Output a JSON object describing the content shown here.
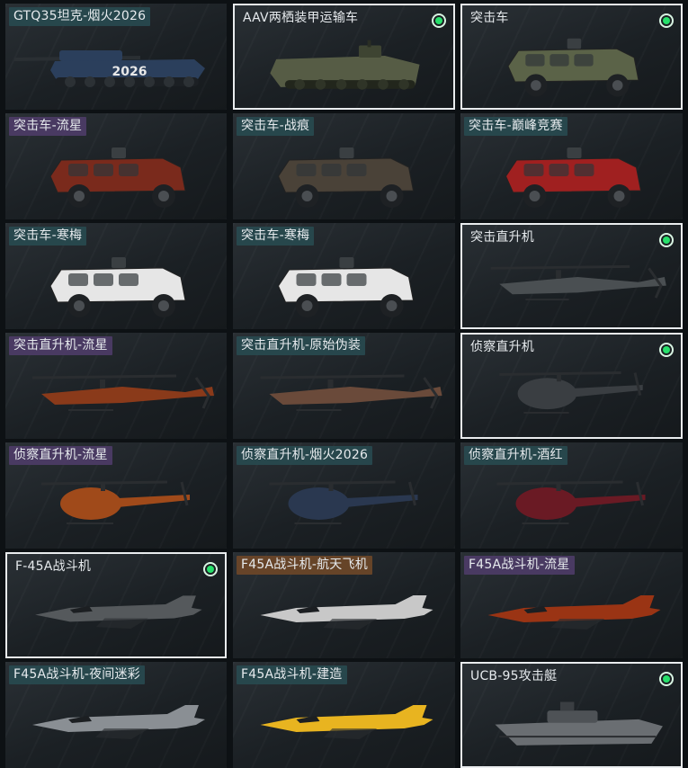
{
  "items": [
    {
      "label": "GTQ35坦克-烟火2026",
      "tag": "teal",
      "selected": false,
      "owned": false,
      "icon": "tank-icon",
      "badge": "2026",
      "color": "#2b3f5c"
    },
    {
      "label": "AAV两栖装甲运输车",
      "tag": "plain",
      "selected": true,
      "owned": true,
      "icon": "amphibious-vehicle-icon",
      "color": "#565c45"
    },
    {
      "label": "突击车",
      "tag": "plain",
      "selected": true,
      "owned": true,
      "icon": "assault-vehicle-icon",
      "color": "#5b6348"
    },
    {
      "label": "突击车-流星",
      "tag": "purple",
      "selected": false,
      "owned": false,
      "icon": "assault-vehicle-icon",
      "color": "#7a2a1c"
    },
    {
      "label": "突击车-战痕",
      "tag": "teal",
      "selected": false,
      "owned": false,
      "icon": "assault-vehicle-icon",
      "color": "#4a4238"
    },
    {
      "label": "突击车-巅峰竞赛",
      "tag": "teal",
      "selected": false,
      "owned": false,
      "icon": "assault-vehicle-icon",
      "color": "#a02020"
    },
    {
      "label": "突击车-寒梅",
      "tag": "teal",
      "selected": false,
      "owned": false,
      "icon": "assault-vehicle-icon",
      "color": "#e6e6e6"
    },
    {
      "label": "突击车-寒梅",
      "tag": "teal",
      "selected": false,
      "owned": false,
      "icon": "assault-vehicle-icon",
      "color": "#e6e6e6"
    },
    {
      "label": "突击直升机",
      "tag": "plain",
      "selected": true,
      "owned": true,
      "icon": "attack-helicopter-icon",
      "color": "#4a4f52"
    },
    {
      "label": "突击直升机-流星",
      "tag": "purple",
      "selected": false,
      "owned": false,
      "icon": "attack-helicopter-icon",
      "color": "#8a3a1a"
    },
    {
      "label": "突击直升机-原始伪装",
      "tag": "teal",
      "selected": false,
      "owned": false,
      "icon": "attack-helicopter-icon",
      "color": "#6a4a3a"
    },
    {
      "label": "侦察直升机",
      "tag": "plain",
      "selected": true,
      "owned": true,
      "icon": "scout-helicopter-icon",
      "color": "#3a3e42"
    },
    {
      "label": "侦察直升机-流星",
      "tag": "purple",
      "selected": false,
      "owned": false,
      "icon": "scout-helicopter-icon",
      "color": "#a04a1a"
    },
    {
      "label": "侦察直升机-烟火2026",
      "tag": "teal",
      "selected": false,
      "owned": false,
      "icon": "scout-helicopter-icon",
      "color": "#2a3850"
    },
    {
      "label": "侦察直升机-酒红",
      "tag": "teal",
      "selected": false,
      "owned": false,
      "icon": "scout-helicopter-icon",
      "color": "#6a1a24"
    },
    {
      "label": "F-45A战斗机",
      "tag": "plain",
      "selected": true,
      "owned": true,
      "icon": "fighter-jet-icon",
      "color": "#55595c"
    },
    {
      "label": "F45A战斗机-航天飞机",
      "tag": "orange",
      "selected": false,
      "owned": false,
      "icon": "fighter-jet-icon",
      "color": "#c8c8c8"
    },
    {
      "label": "F45A战斗机-流星",
      "tag": "purple",
      "selected": false,
      "owned": false,
      "icon": "fighter-jet-icon",
      "color": "#9a3414"
    },
    {
      "label": "F45A战斗机-夜间迷彩",
      "tag": "teal",
      "selected": false,
      "owned": false,
      "icon": "fighter-jet-icon",
      "color": "#8a8f94"
    },
    {
      "label": "F45A战斗机-建造",
      "tag": "teal",
      "selected": false,
      "owned": false,
      "icon": "fighter-jet-icon",
      "color": "#e8b420"
    },
    {
      "label": "UCB-95攻击艇",
      "tag": "plain",
      "selected": true,
      "owned": true,
      "icon": "attack-boat-icon",
      "color": "#6a6e72"
    }
  ],
  "colors": {
    "owned": "#27e06b",
    "selected_border": "#e9ecee",
    "background": "#0d1114"
  }
}
